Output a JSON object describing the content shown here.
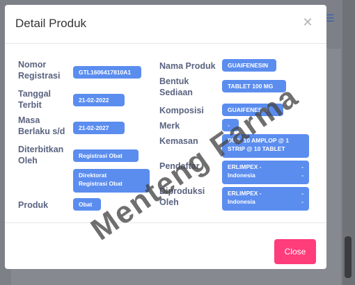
{
  "modal": {
    "title": "Detail Produk",
    "close_icon": "close-icon",
    "close_button": "Close"
  },
  "fields_left": [
    {
      "label": [
        "Nomor",
        "Registrasi"
      ],
      "value": [
        "GTL1606417810A1"
      ]
    },
    {
      "label": [
        "Tanggal",
        "Terbit"
      ],
      "value": [
        "21-02-2022"
      ]
    },
    {
      "label": [
        "Masa",
        "Berlaku s/d"
      ],
      "value": [
        "21-02-2027"
      ]
    },
    {
      "label": [
        "Diterbitkan",
        "Oleh"
      ],
      "value": [
        "Registrasi Obat"
      ]
    },
    {
      "label": [
        ""
      ],
      "value": [
        "Direktorat",
        "Registrasi Obat"
      ]
    },
    {
      "label": [
        "Produk"
      ],
      "value": [
        "Obat"
      ]
    }
  ],
  "fields_right": [
    {
      "label": [
        "Nama Produk"
      ],
      "value": [
        "GUAIFENESIN"
      ]
    },
    {
      "label": [
        "Bentuk",
        "Sediaan"
      ],
      "value": [
        "TABLET 100 MG"
      ]
    },
    {
      "label": [
        "Komposisi"
      ],
      "value": [
        "GUAIFENESIN"
      ]
    },
    {
      "label": [
        "Merk"
      ],
      "value": [
        "-"
      ]
    },
    {
      "label": [
        "Kemasan"
      ],
      "value": [
        "DUS, 10 AMPLOP @ 1",
        "STRIP @ 10 TABLET"
      ]
    },
    {
      "label": [
        "Pendaftar"
      ],
      "value": [
        "ERLIMPEX -",
        "Indonesia"
      ],
      "dash": "-"
    },
    {
      "label": [
        "Diproduksi",
        "Oleh"
      ],
      "value": [
        "ERLIMPEX -",
        "Indonesia"
      ],
      "dash": "-"
    }
  ],
  "watermark": "Menteng Farma",
  "colors": {
    "badge": "#5b8def",
    "close_button": "#ff3d7a",
    "label_text": "#5a6380"
  }
}
